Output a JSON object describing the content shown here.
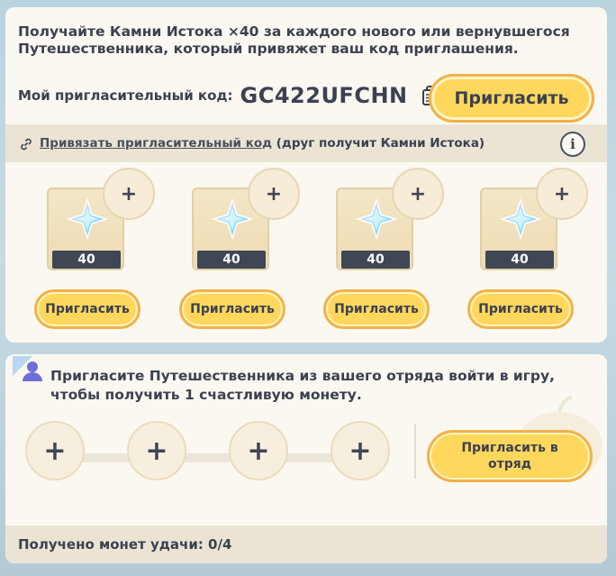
{
  "referral": {
    "header": "Получайте Камни Истока ×40 за каждого нового или вернувшегося Путешественника, который привяжет ваш код приглашения.",
    "code_label": "Мой пригласительный код:",
    "code_value": "GC422UFCHN",
    "invite_button": "Пригласить",
    "bind_link": "Привязать пригласительный код",
    "bind_note": " (друг получит Камни Истока)",
    "info_label": "i",
    "slots": [
      {
        "quantity": "40",
        "add": "+",
        "button": "Пригласить"
      },
      {
        "quantity": "40",
        "add": "+",
        "button": "Пригласить"
      },
      {
        "quantity": "40",
        "add": "+",
        "button": "Пригласить"
      },
      {
        "quantity": "40",
        "add": "+",
        "button": "Пригласить"
      }
    ]
  },
  "team": {
    "text": "Пригласите Путешественника из вашего отряда войти в игру, чтобы получить 1 счастливую монету.",
    "slots": [
      "+",
      "+",
      "+",
      "+"
    ],
    "invite_button": "Пригласить в отряд",
    "coins_status": "Получено монет удачи: 0/4"
  },
  "icons": {
    "copy": "copy-icon",
    "link": "link-icon",
    "info": "info-icon",
    "gem": "primogem-icon",
    "team": "team-member-icon"
  },
  "colors": {
    "button_fill": "#ffd75c",
    "button_border": "#f1b24a",
    "card_bg": "#fbf8f1",
    "bar_bg": "#ebe4d4",
    "text": "#3b4150"
  }
}
